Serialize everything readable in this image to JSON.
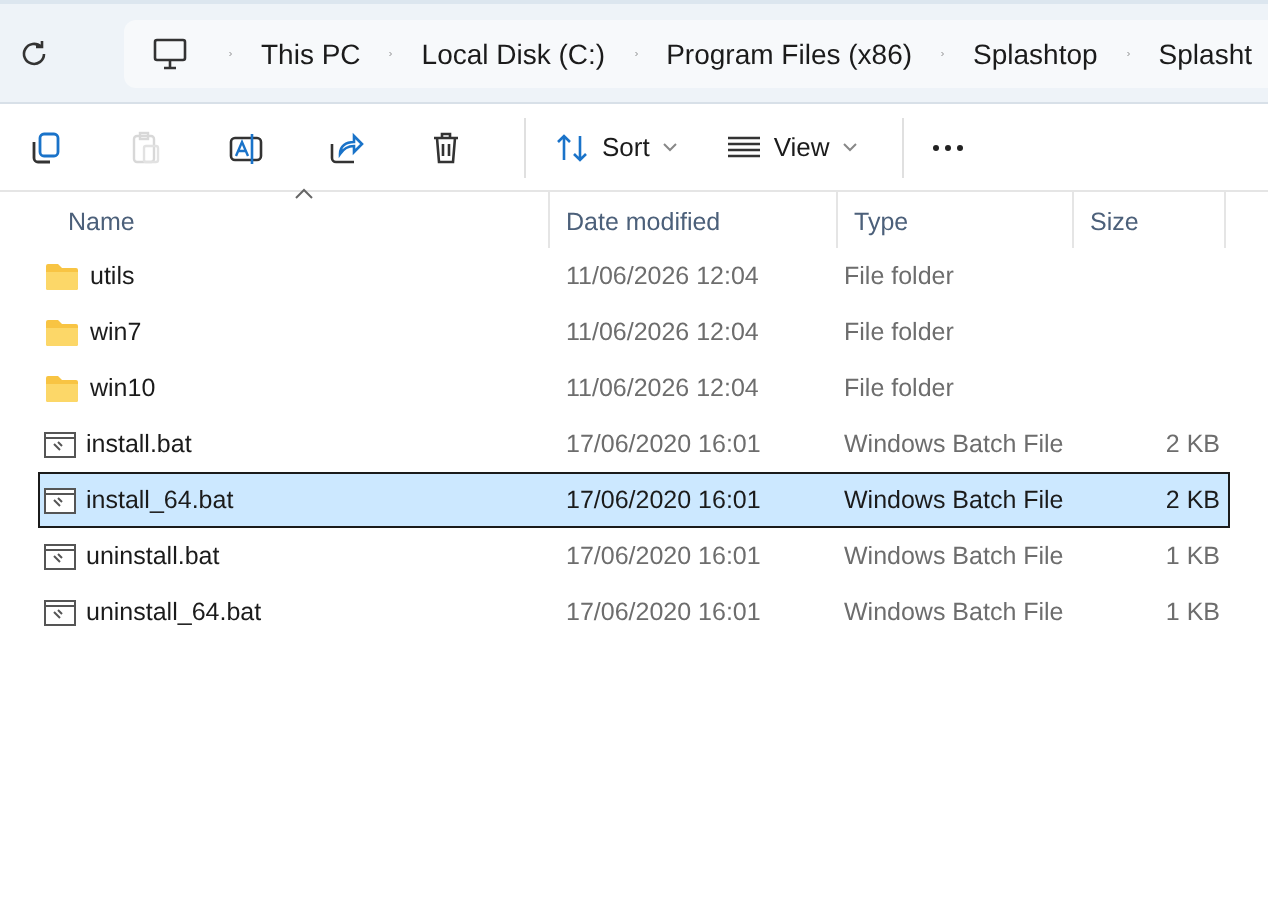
{
  "breadcrumb": [
    "This PC",
    "Local Disk (C:)",
    "Program Files (x86)",
    "Splashtop",
    "Splasht"
  ],
  "toolbar": [
    {
      "kind": "copy",
      "disabled": false
    },
    {
      "kind": "paste",
      "disabled": true
    },
    {
      "kind": "rename",
      "disabled": false
    },
    {
      "kind": "share",
      "disabled": false
    },
    {
      "kind": "delete",
      "disabled": false
    },
    {
      "kind": "sort",
      "label": "Sort",
      "disabled": false
    },
    {
      "kind": "view",
      "label": "View",
      "disabled": false
    },
    {
      "kind": "more",
      "disabled": false
    }
  ],
  "table": {
    "columns": [
      "Name",
      "Date modified",
      "Type",
      "Size"
    ],
    "rows": [
      {
        "kind": "folder",
        "name": "utils",
        "date": "11/06/2026 12:04",
        "type": "File folder",
        "selected": false
      },
      {
        "kind": "folder",
        "name": "win7",
        "date": "11/06/2026 12:04",
        "type": "File folder",
        "selected": false
      },
      {
        "kind": "folder",
        "name": "win10",
        "date": "11/06/2026 12:04",
        "type": "File folder",
        "selected": false
      },
      {
        "kind": "batch",
        "name": "install.bat",
        "date": "17/06/2020 16:01",
        "type": "Windows Batch File",
        "size": "2 KB",
        "selected": false
      },
      {
        "kind": "batch",
        "name": "install_64.bat",
        "date": "17/06/2020 16:01",
        "type": "Windows Batch File",
        "size": "2 KB",
        "selected": true
      },
      {
        "kind": "batch",
        "name": "uninstall.bat",
        "date": "17/06/2020 16:01",
        "type": "Windows Batch File",
        "size": "1 KB",
        "selected": false
      },
      {
        "kind": "batch",
        "name": "uninstall_64.bat",
        "date": "17/06/2020 16:01",
        "type": "Windows Batch File",
        "size": "1 KB",
        "selected": false
      }
    ]
  }
}
